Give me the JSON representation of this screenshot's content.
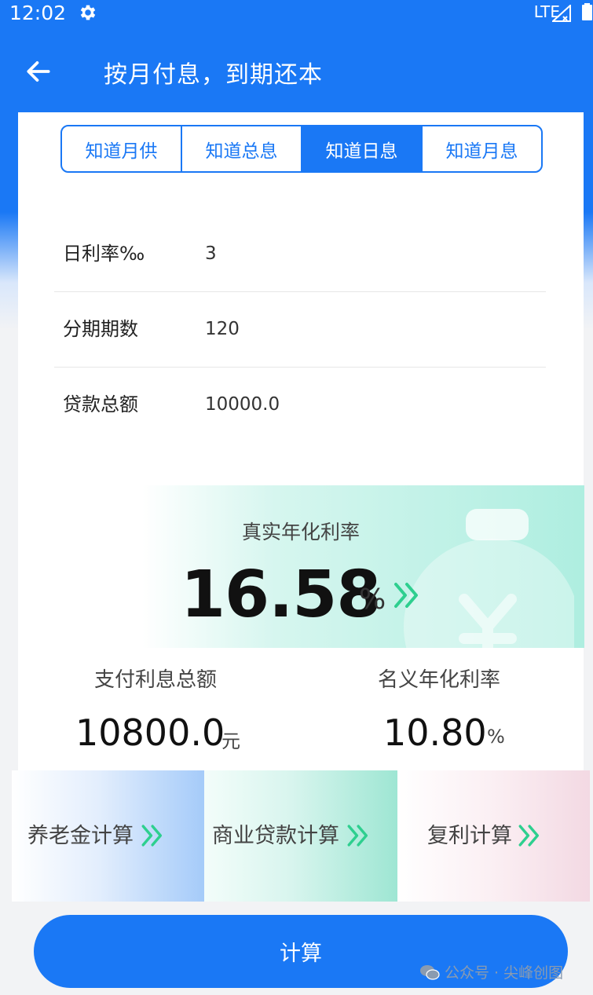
{
  "status_bar": {
    "time": "12:02",
    "network": "LTE",
    "icons": [
      "settings-gear-icon",
      "signal-icon",
      "battery-icon"
    ]
  },
  "app_bar": {
    "title": "按月付息，到期还本",
    "back_icon": "arrow-left-icon"
  },
  "tabs": [
    {
      "label": "知道月供",
      "active": false
    },
    {
      "label": "知道总息",
      "active": false
    },
    {
      "label": "知道日息",
      "active": true
    },
    {
      "label": "知道月息",
      "active": false
    }
  ],
  "form": {
    "daily_rate": {
      "label": "日利率‰",
      "value": "3"
    },
    "periods": {
      "label": "分期期数",
      "value": "120"
    },
    "loan_amount": {
      "label": "贷款总额",
      "value": "10000.0"
    }
  },
  "result": {
    "real_rate_label": "真实年化利率",
    "real_rate_value": "16.58",
    "real_rate_unit": "%",
    "total_interest_label": "支付利息总额",
    "total_interest_value": "10800.0",
    "total_interest_unit": "元",
    "nominal_rate_label": "名义年化利率",
    "nominal_rate_value": "10.80",
    "nominal_rate_unit": "%"
  },
  "tiles": [
    {
      "label": "养老金计算",
      "icon": "double-chevron-right-icon"
    },
    {
      "label": "商业贷款计算",
      "icon": "double-chevron-right-icon"
    },
    {
      "label": "复利计算",
      "icon": "double-chevron-right-icon"
    }
  ],
  "calculate_button": {
    "label": "计算"
  },
  "watermark": {
    "text": "公众号 · 尖峰创图"
  },
  "colors": {
    "primary": "#1a78f5",
    "accent_green": "#2ecf8f"
  }
}
